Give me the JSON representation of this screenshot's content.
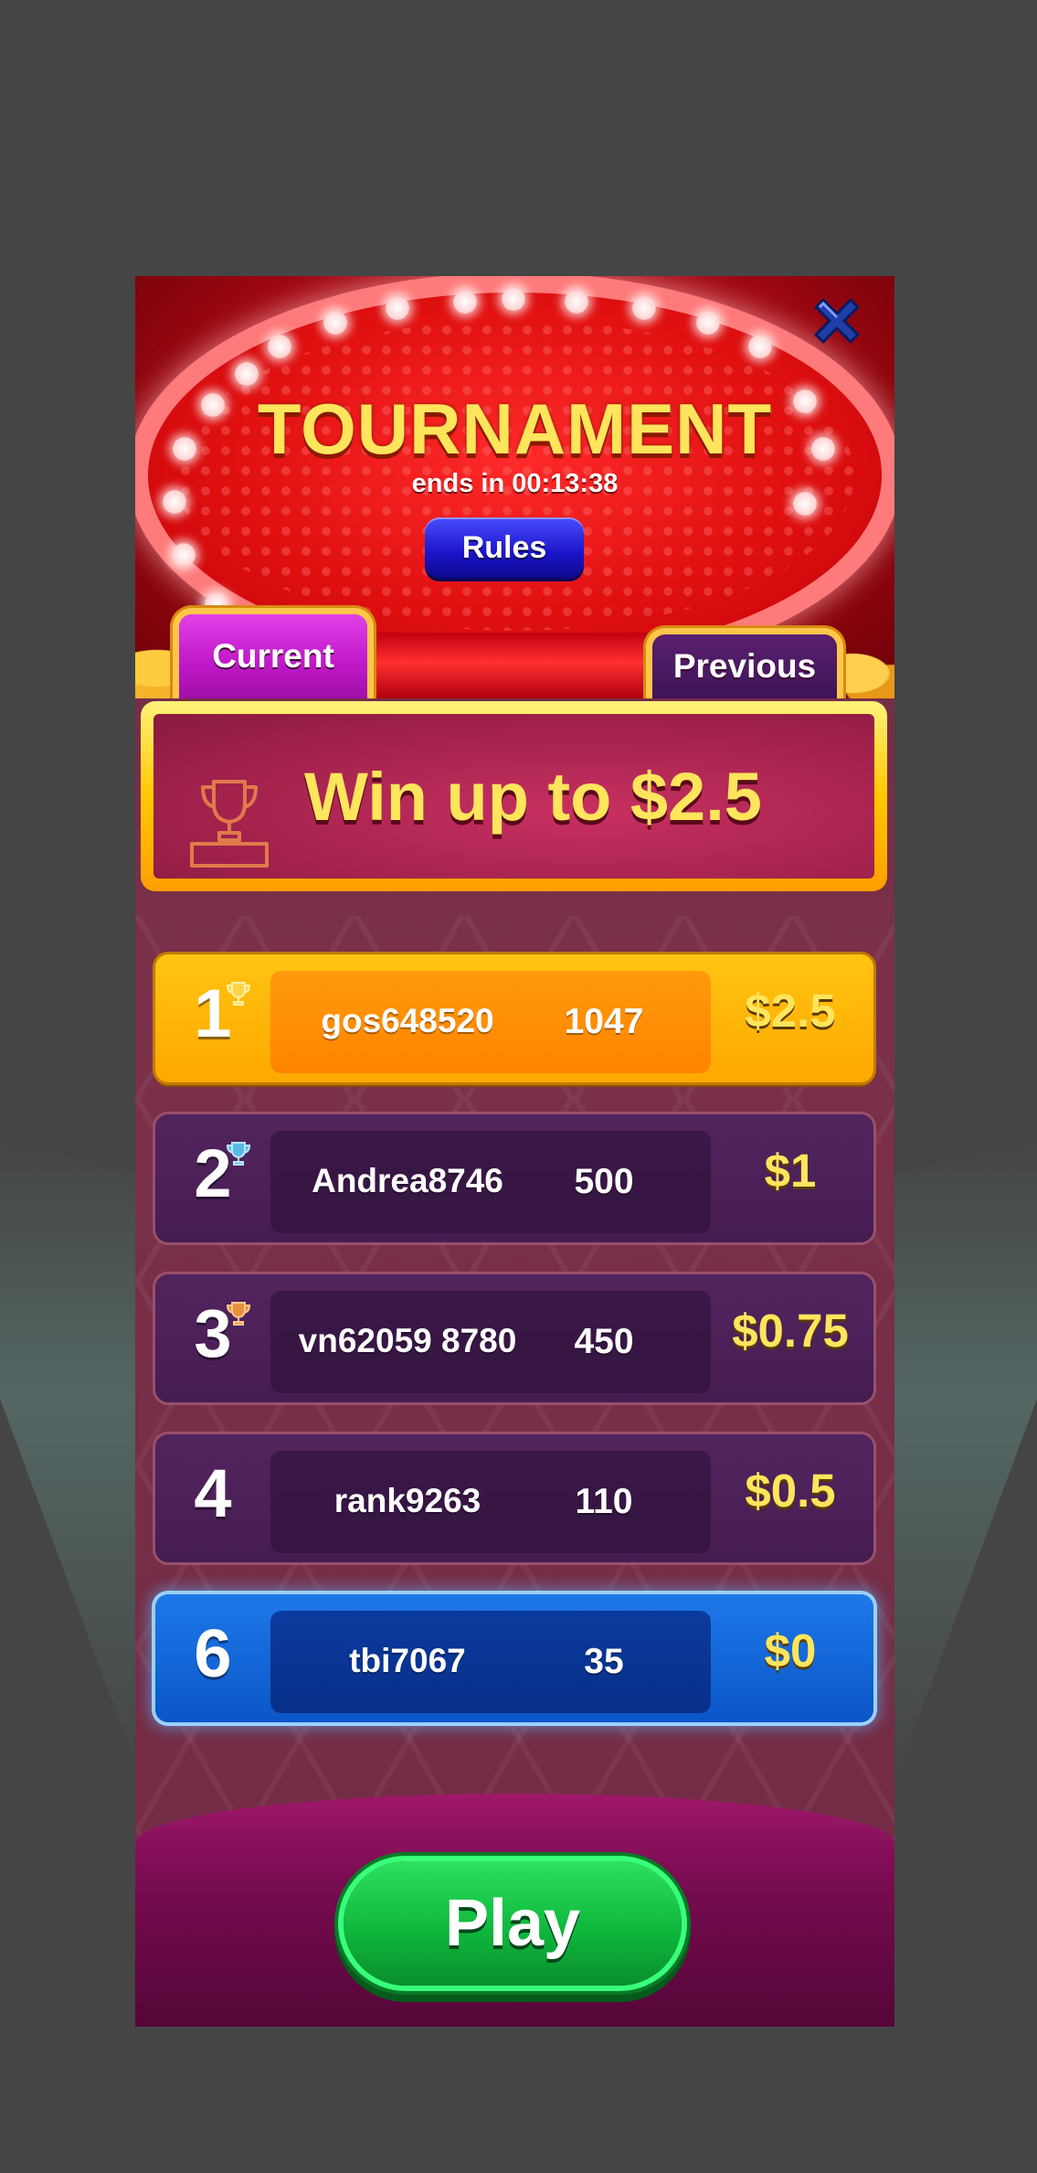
{
  "header": {
    "title": "TOURNAMENT",
    "countdown": "ends in 00:13:38",
    "rules_label": "Rules"
  },
  "tabs": [
    {
      "label": "Current",
      "active": true
    },
    {
      "label": "Previous",
      "active": false
    }
  ],
  "prize_banner": {
    "text": "Win up to $2.5"
  },
  "leaderboard": [
    {
      "rank": "1",
      "name": "gos648520",
      "score": "1047",
      "prize": "$2.5",
      "style": "gold",
      "trophy": "gold-trophy-icon"
    },
    {
      "rank": "2",
      "name": "Andrea8746",
      "score": "500",
      "prize": "$1",
      "style": "purple",
      "trophy": "silver-trophy-icon"
    },
    {
      "rank": "3",
      "name": "vn62059 8780",
      "score": "450",
      "prize": "$0.75",
      "style": "purple",
      "trophy": "bronze-trophy-icon"
    },
    {
      "rank": "4",
      "name": "rank9263",
      "score": "110",
      "prize": "$0.5",
      "style": "purple",
      "trophy": ""
    },
    {
      "rank": "6",
      "name": "tbi7067",
      "score": "35",
      "prize": "$0",
      "style": "blue-current-user",
      "trophy": ""
    }
  ],
  "play_label": "Play",
  "colors": {
    "accent_gold": "#ffe55c",
    "header_red": "#e01010",
    "play_green": "#0fb83c",
    "current_user_blue": "#1e78e8"
  }
}
